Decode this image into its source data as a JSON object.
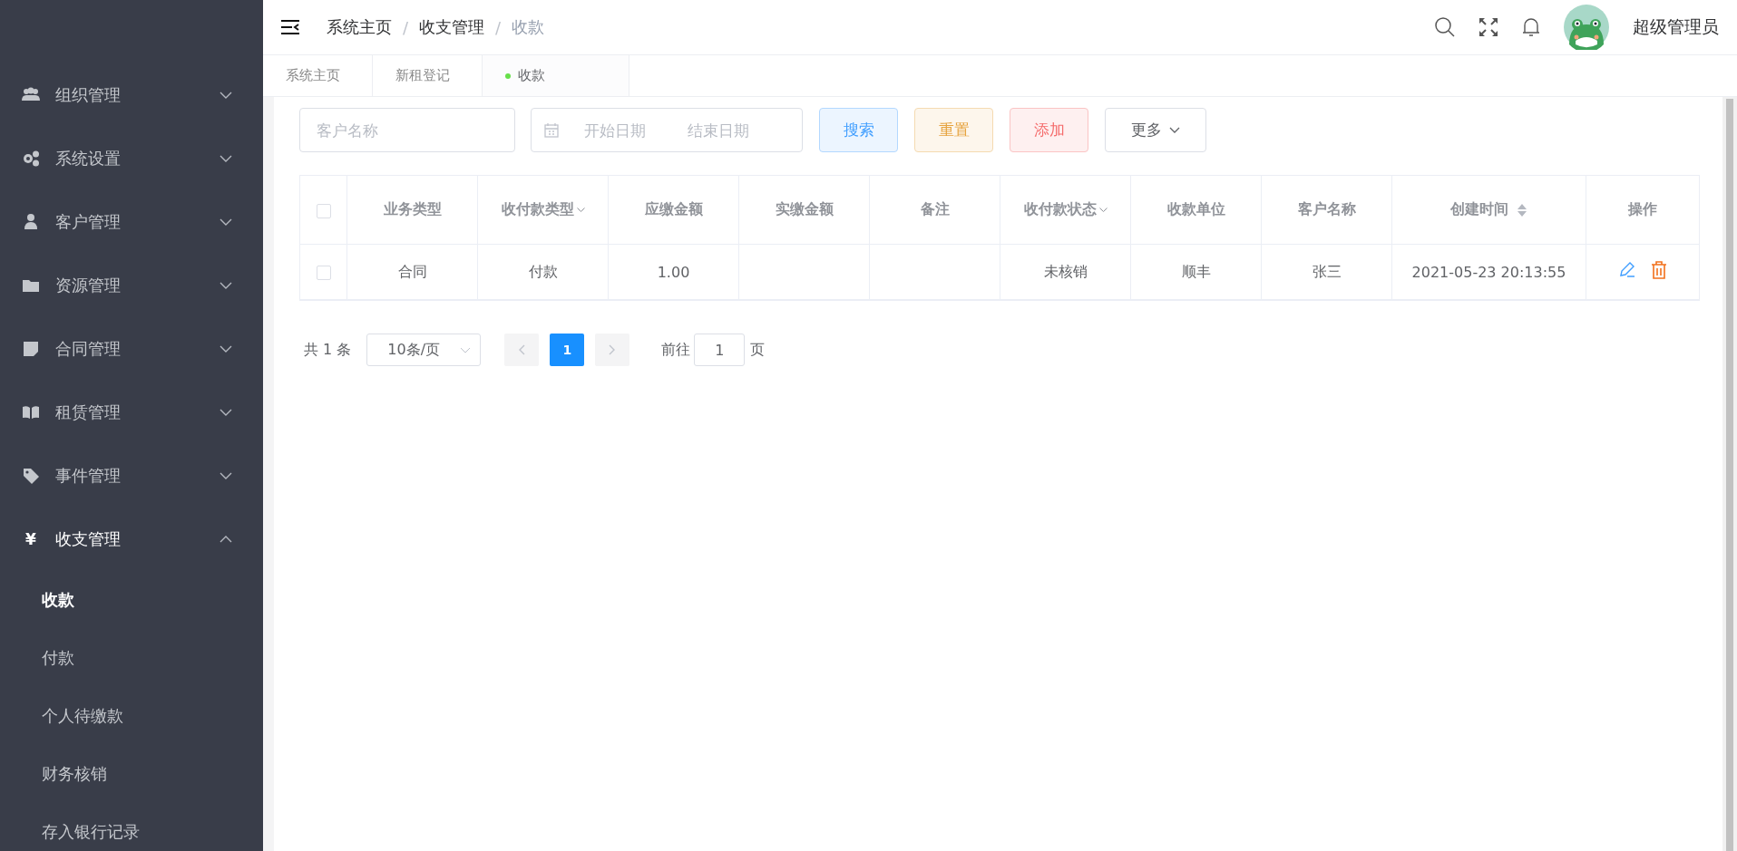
{
  "sidebar": {
    "menu": [
      {
        "label": "组织管理",
        "expanded": false
      },
      {
        "label": "系统设置",
        "expanded": false
      },
      {
        "label": "客户管理",
        "expanded": false
      },
      {
        "label": "资源管理",
        "expanded": false
      },
      {
        "label": "合同管理",
        "expanded": false
      },
      {
        "label": "租赁管理",
        "expanded": false
      },
      {
        "label": "事件管理",
        "expanded": false
      },
      {
        "label": "收支管理",
        "glyph": "¥",
        "expanded": true,
        "children": [
          {
            "label": "收款",
            "selected": true
          },
          {
            "label": "付款",
            "selected": false
          },
          {
            "label": "个人待缴款",
            "selected": false
          },
          {
            "label": "财务核销",
            "selected": false
          },
          {
            "label": "存入银行记录",
            "selected": false
          }
        ]
      }
    ]
  },
  "header": {
    "breadcrumb": [
      {
        "label": "系统主页",
        "current": false
      },
      {
        "label": "收支管理",
        "current": false
      },
      {
        "label": "收款",
        "current": true
      }
    ],
    "separator": "/",
    "user_name": "超级管理员"
  },
  "tabs": [
    {
      "label": "系统主页",
      "selected": false
    },
    {
      "label": "新租登记",
      "selected": false
    },
    {
      "label": "收款",
      "selected": true
    }
  ],
  "filters": {
    "customer": {
      "placeholder": "客户名称"
    },
    "date_range": {
      "start_placeholder": "开始日期",
      "end_placeholder": "结束日期"
    }
  },
  "buttons": [
    {
      "label": "搜索",
      "kind": "primary"
    },
    {
      "label": "重置",
      "kind": "warning"
    },
    {
      "label": "添加",
      "kind": "danger"
    },
    {
      "label": "更多",
      "kind": "dropdown"
    }
  ],
  "table": {
    "select_all_checked": false,
    "columns": [
      {
        "label": "业务类型",
        "filterable": false,
        "sortable": false
      },
      {
        "label": "收付款类型",
        "filterable": true,
        "sortable": false
      },
      {
        "label": "应缴金额",
        "filterable": false,
        "sortable": false
      },
      {
        "label": "实缴金额",
        "filterable": false,
        "sortable": false
      },
      {
        "label": "备注",
        "filterable": false,
        "sortable": false
      },
      {
        "label": "收付款状态",
        "filterable": true,
        "sortable": false
      },
      {
        "label": "收款单位",
        "filterable": false,
        "sortable": false
      },
      {
        "label": "客户名称",
        "filterable": false,
        "sortable": false
      },
      {
        "label": "创建时间",
        "filterable": false,
        "sortable": true
      },
      {
        "label": "操作",
        "filterable": false,
        "sortable": false
      }
    ],
    "rows": [
      {
        "checked": false,
        "cells": [
          "合同",
          "付款",
          "1.00",
          "",
          "",
          "未核销",
          "顺丰",
          "张三",
          "2021-05-23 20:13:55"
        ]
      }
    ]
  },
  "pagination": {
    "total": "共 1 条",
    "page_size": "10条/页",
    "pages": [
      {
        "label": "1",
        "selected": true
      }
    ],
    "goto_label": "前往",
    "goto_value": "1",
    "goto_suffix": "页"
  }
}
